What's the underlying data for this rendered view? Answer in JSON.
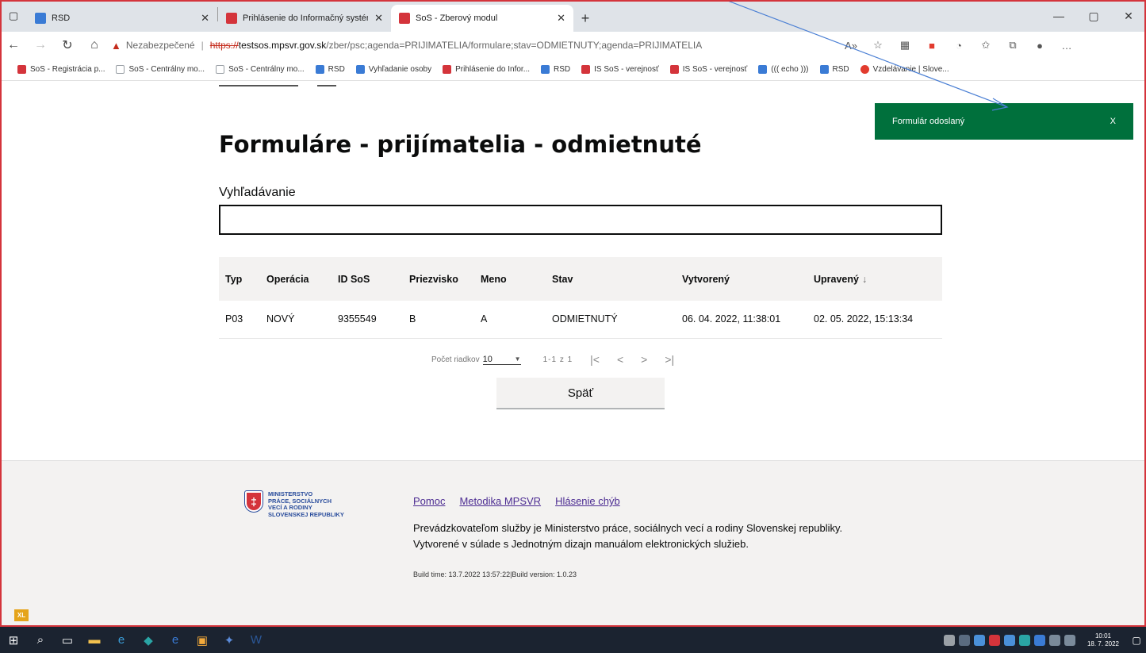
{
  "browser": {
    "tabs": [
      {
        "title": "RSD",
        "active": false
      },
      {
        "title": "Prihlásenie do Informačný systém",
        "active": false
      },
      {
        "title": "SoS - Zberový modul",
        "active": true
      }
    ],
    "address": {
      "warning": "Nezabezpečené",
      "scheme": "https://",
      "host": "testsos.mpsvr.gov.sk",
      "path": "/zber/psc;agenda=PRIJIMATELIA/formulare;stav=ODMIETNUTY;agenda=PRIJIMATELIA"
    },
    "favorites": [
      {
        "label": "SoS - Registrácia p...",
        "color": "#d4343b"
      },
      {
        "label": "SoS - Centrálny mo...",
        "color": "#9aa0a6"
      },
      {
        "label": "SoS - Centrálny mo...",
        "color": "#9aa0a6"
      },
      {
        "label": "RSD",
        "color": "#3a7bd5"
      },
      {
        "label": "Vyhľadanie osoby",
        "color": "#3a7bd5"
      },
      {
        "label": "Prihlásenie do Infor...",
        "color": "#d4343b"
      },
      {
        "label": "RSD",
        "color": "#3a7bd5"
      },
      {
        "label": "IS SoS - verejnosť",
        "color": "#d4343b"
      },
      {
        "label": "IS SoS - verejnosť",
        "color": "#d4343b"
      },
      {
        "label": "((( echo )))",
        "color": "#3a7bd5"
      },
      {
        "label": "RSD",
        "color": "#3a7bd5"
      },
      {
        "label": "Vzdelávanie | Slove...",
        "color": "#e23b2e"
      }
    ]
  },
  "page": {
    "title": "Formuláre - prijímatelia - odmietnuté",
    "search_label": "Vyhľadávanie",
    "search_value": "",
    "table": {
      "columns": [
        "Typ",
        "Operácia",
        "ID SoS",
        "Priezvisko",
        "Meno",
        "Stav",
        "Vytvorený",
        "Upravený"
      ],
      "rows": [
        [
          "P03",
          "NOVÝ",
          "9355549",
          "B",
          "A",
          "ODMIETNUTÝ",
          "06. 04. 2022, 11:38:01",
          "02. 05. 2022, 15:13:34"
        ]
      ]
    },
    "pager": {
      "rows_label": "Počet riadkov",
      "rows_value": "10",
      "range": "1-1 z 1"
    },
    "back_button": "Späť"
  },
  "toast": {
    "message": "Formulár odoslaný",
    "close": "X"
  },
  "footer": {
    "logo_lines": [
      "MINISTERSTVO",
      "PRÁCE, SOCIÁLNYCH",
      "VECÍ A RODINY",
      "SLOVENSKEJ REPUBLIKY"
    ],
    "links": [
      "Pomoc",
      "Metodika MPSVR",
      "Hlásenie chýb"
    ],
    "info_line1": "Prevádzkovateľom služby je Ministerstvo práce, sociálnych vecí a rodiny Slovenskej republiky.",
    "info_line2": "Vytvorené v súlade s Jednotným dizajn manuálom elektronických služieb.",
    "build": "Build time: 13.7.2022 13:57:22|Build version: 1.0.23"
  },
  "badge": "XL",
  "taskbar": {
    "time": "10:01",
    "date": "18. 7. 2022"
  }
}
